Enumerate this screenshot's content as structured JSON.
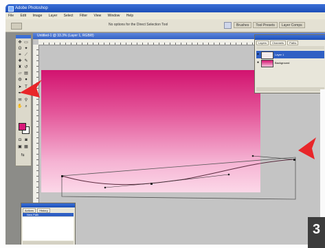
{
  "app": {
    "title": "Adobe Photoshop"
  },
  "menu": [
    "File",
    "Edit",
    "Image",
    "Layer",
    "Select",
    "Filter",
    "View",
    "Window",
    "Help"
  ],
  "options_bar": {
    "hint": "No options for the Direct Selection Tool",
    "palette_tabs": [
      "Brushes",
      "Tool Presets",
      "Layer Comps"
    ]
  },
  "document": {
    "title": "Untitled-1 @ 33.3% (Layer 1, RGB/8)"
  },
  "colors": {
    "foreground": "#d8197a",
    "background": "#ffffff",
    "arrow": "#e8262a"
  },
  "layers_panel": {
    "tabs": [
      "Layers",
      "Channels",
      "Paths"
    ],
    "layers": [
      {
        "name": "Layer 1",
        "selected": true
      },
      {
        "name": "Background",
        "selected": false
      }
    ]
  },
  "history_panel": {
    "tabs": [
      "Actions",
      "History"
    ],
    "state": "New Path"
  },
  "step_badge": "3"
}
